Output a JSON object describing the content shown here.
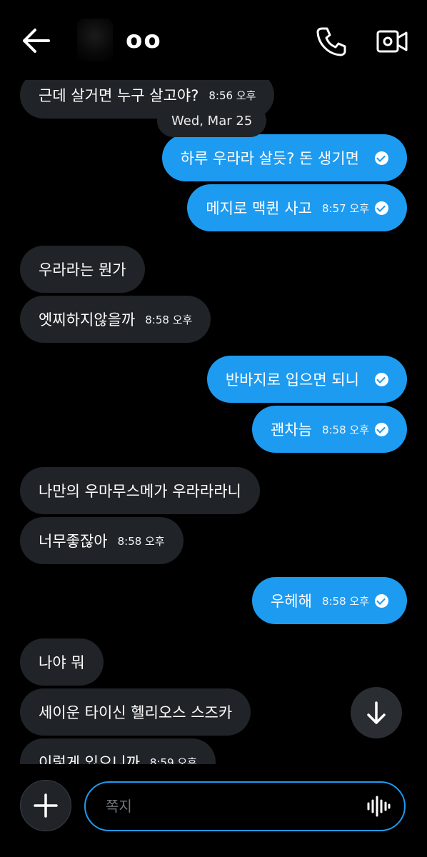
{
  "header": {
    "contact_name": "oo"
  },
  "date_separator": "Wed, Mar 25",
  "messages": [
    {
      "direction": "in",
      "text": "근데 살거면 누구 살고야?",
      "time": "8:56 오후"
    },
    {
      "direction": "out",
      "text": "하루 우라라 살듯? 돈 생기면",
      "time": ""
    },
    {
      "direction": "out",
      "text": "메지로 맥퀸 사고",
      "time": "8:57 오후"
    },
    {
      "direction": "in",
      "text": "우라라는 뭔가",
      "time": ""
    },
    {
      "direction": "in",
      "text": "엣찌하지않을까",
      "time": "8:58 오후"
    },
    {
      "direction": "out",
      "text": "반바지로 입으면 되니",
      "time": ""
    },
    {
      "direction": "out",
      "text": "괜차늠",
      "time": "8:58 오후"
    },
    {
      "direction": "in",
      "text": "나만의 우마무스메가 우라라라니",
      "time": ""
    },
    {
      "direction": "in",
      "text": "너무좋잖아",
      "time": "8:58 오후"
    },
    {
      "direction": "out",
      "text": "우헤해",
      "time": "8:58 오후"
    },
    {
      "direction": "in",
      "text": "나야 뭐",
      "time": ""
    },
    {
      "direction": "in",
      "text": "세이운 타이신 헬리오스 스즈카",
      "time": ""
    },
    {
      "direction": "in",
      "text": "이렇게 있으니까",
      "time": "8:59 오후"
    }
  ],
  "composer": {
    "placeholder": "쪽지"
  },
  "icons": {
    "back": "arrow-left-icon",
    "call": "phone-icon",
    "video": "video-camera-icon",
    "scroll_down": "arrow-down-icon",
    "add": "plus-icon",
    "voice": "voice-waveform-icon"
  },
  "colors": {
    "accent": "#1d9bf0",
    "incoming_bubble": "#202327",
    "background": "#000000"
  }
}
